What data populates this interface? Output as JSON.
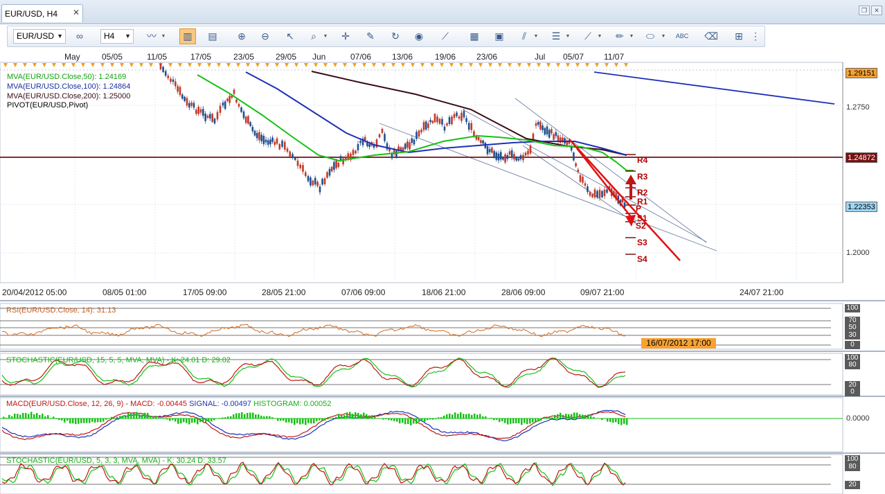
{
  "tab": {
    "title": "EUR/USD, H4",
    "close": "✕"
  },
  "window_buttons": [
    "restore",
    "close"
  ],
  "toolbar": {
    "symbol": "EUR/USD",
    "timeframe": "H4",
    "icons": [
      "link-icon",
      "line-chart-icon",
      "bar-chart-icon",
      "candle-chart-icon",
      "zoom-in-icon",
      "zoom-out-icon",
      "cursor-icon",
      "zoom-box-icon",
      "crosshair-icon",
      "highlight-icon",
      "refresh-icon",
      "globe-icon",
      "ruler-icon",
      "screenshot-icon",
      "template-icon",
      "draw-lines-icon",
      "indicators-icon",
      "trendline-icon",
      "pen-icon",
      "ellipse-icon",
      "text-icon",
      "eraser-icon",
      "hierarchy-icon",
      "options-icon"
    ]
  },
  "top_axis_labels": [
    "May",
    "05/05",
    "11/05",
    "17/05",
    "23/05",
    "29/05",
    "Jun",
    "07/06",
    "13/06",
    "19/06",
    "23/06",
    "Jul",
    "05/07",
    "11/07"
  ],
  "bottom_axis_labels": [
    "20/04/2012 05:00",
    "08/05 01:00",
    "17/05 09:00",
    "28/05 21:00",
    "07/06 09:00",
    "18/06 21:00",
    "28/06 09:00",
    "09/07 21:00",
    "24/07 21:00"
  ],
  "highlight_date": "16/07/2012 17:00",
  "price_axis": {
    "ticks": [
      "1.2750",
      "1.2000"
    ],
    "tags": [
      {
        "value": "1.29151",
        "bg": "#f7a233",
        "fg": "#000000"
      },
      {
        "value": "1.24872",
        "bg": "#7a1010",
        "fg": "#ffffff"
      },
      {
        "value": "1.22353",
        "bg": "#9fd6f2",
        "fg": "#000000"
      }
    ]
  },
  "legend": [
    {
      "text": "MVA(EUR/USD.Close,50): 1.24169",
      "color": "#14a014"
    },
    {
      "text": "MVA(EUR/USD.Close,100): 1.24864",
      "color": "#1a2fa0"
    },
    {
      "text": "MVA(EUR/USD.Close,200): 1.25000",
      "color": "#3a0a14"
    },
    {
      "text": "PIVOT(EUR/USD,Pivot)",
      "color": "#000000"
    }
  ],
  "pivot_levels": [
    "R4",
    "R3",
    "R2",
    "R1",
    "P",
    "S1",
    "S2",
    "S3",
    "S4"
  ],
  "indicators": {
    "rsi": {
      "title": "RSI(EUR/USD.Close, 14): 31.13",
      "color": "#d2691e",
      "levels": [
        "100",
        "70",
        "50",
        "30",
        "0"
      ]
    },
    "stoch1": {
      "title": "STOCHASTIC(EUR/USD, 15, 5, 5, MVA, MVA) -  K: 24.01  D: 29.02",
      "levels": [
        "100",
        "80",
        "20",
        "0"
      ]
    },
    "macd": {
      "title_prefix": "MACD(EUR/USD.Close, 12, 26, 9) -  MACD: -0.00445",
      "signal": "SIGNAL: -0.00497",
      "histogram": "HISTOGRAM: 0.00052",
      "axis": "0.0000"
    },
    "stoch2": {
      "title": "STOCHASTIC(EUR/USD, 5, 3, 3, MVA, MVA) -  K: 30.24  D: 33.57",
      "levels": [
        "100",
        "80",
        "20"
      ]
    }
  },
  "colors": {
    "ma50": "#16c116",
    "ma100": "#1c2fb8",
    "ma200": "#3a0a14",
    "pivot": "#7a1010",
    "arrow": "#e01010",
    "bull": "#1f4f8f",
    "bear": "#c0392b"
  }
}
